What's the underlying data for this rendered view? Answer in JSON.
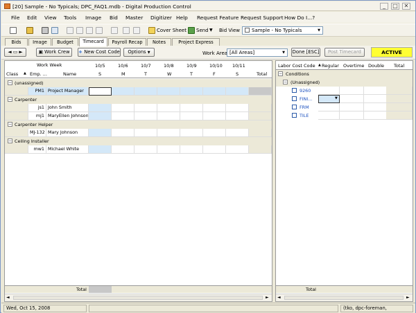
{
  "window": {
    "title": "[20] Sample - No Typicals; DPC_FAQ1.mdb - Digital Production Control",
    "min": "_",
    "max": "□",
    "close": "✕"
  },
  "menu": [
    "File",
    "Edit",
    "View",
    "Tools",
    "Image",
    "Bid",
    "Master",
    "Digitizer",
    "Help",
    "Request Feature",
    "Request Support",
    "How Do I...?"
  ],
  "toolbar": {
    "cover_sheet": "Cover Sheet",
    "send": "Send",
    "bid_view_label": "Bid View",
    "bid_view_value": "Sample - No Typicals"
  },
  "tabs": [
    "Bids",
    "Image",
    "Budget",
    "Timecard",
    "Payroll Recap",
    "Notes",
    "Project Express"
  ],
  "controls": {
    "work_crew": "Work Crew",
    "new_cost_code": "New Cost Code",
    "options": "Options",
    "work_area_label": "Work Area",
    "work_area_value": "[All Areas]",
    "done": "Done [ESC]",
    "post_timecard": "Post Timecard",
    "status_badge": "ACTIVE"
  },
  "grid": {
    "work_week_label": "Work Week",
    "dates": [
      "10/5",
      "10/6",
      "10/7",
      "10/8",
      "10/9",
      "10/10",
      "10/11"
    ],
    "days": [
      "S",
      "M",
      "T",
      "W",
      "T",
      "F",
      "S"
    ],
    "col_class": "Class",
    "col_emp": "Emp. ...",
    "col_name": "Name",
    "col_total": "Total",
    "groups": [
      {
        "label": "(unassigned)",
        "rows": [
          {
            "emp": "PM1",
            "name": "Project Manager"
          }
        ]
      },
      {
        "label": "Carpenter",
        "rows": [
          {
            "emp": "js1",
            "name": "John Smith"
          },
          {
            "emp": "mj1",
            "name": "MaryEllen Johnson"
          }
        ]
      },
      {
        "label": "Carpenter Helper",
        "rows": [
          {
            "emp": "MJ-132",
            "name": "Mary Johnson"
          }
        ]
      },
      {
        "label": "Ceiling Installer",
        "rows": [
          {
            "emp": "mw1",
            "name": "Michael White"
          }
        ]
      }
    ],
    "footer_total": "Total"
  },
  "right": {
    "col_labor": "Labor Cost Code",
    "col_regular": "Regular",
    "col_overtime": "Overtime",
    "col_double": "Double",
    "col_total": "Total",
    "conditions": "Conditions",
    "unassigned": "(Unassigned)",
    "codes": [
      "9260",
      "FINI...",
      "FRM",
      "TILE"
    ],
    "footer_total": "Total"
  },
  "statusbar": {
    "date": "Wed, Oct 15, 2008",
    "user": "(tko, dpc-foreman,"
  },
  "colors": {
    "active_badge": "#ffff33",
    "highlight": "#d4e8f8",
    "group_bg": "#ece9d8",
    "link": "#1a4fbf"
  }
}
